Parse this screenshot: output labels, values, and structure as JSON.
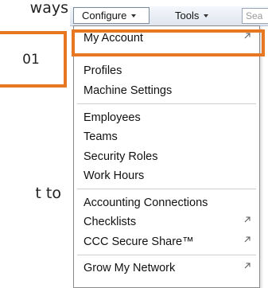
{
  "background_text": {
    "top": "ways",
    "bottom": "t to"
  },
  "menubar": {
    "configure_label": "Configure",
    "tools_label": "Tools",
    "search_text": "Sea"
  },
  "menu": {
    "items": [
      {
        "label": "My Account",
        "external": true
      },
      {
        "label": "Profiles",
        "external": false
      },
      {
        "label": "Machine Settings",
        "external": false
      },
      {
        "label": "Employees",
        "external": false
      },
      {
        "label": "Teams",
        "external": false
      },
      {
        "label": "Security Roles",
        "external": false
      },
      {
        "label": "Work Hours",
        "external": false
      },
      {
        "label": "Accounting Connections",
        "external": false
      },
      {
        "label": "Checklists",
        "external": true
      },
      {
        "label": "CCC Secure Share™",
        "external": true
      },
      {
        "label": "Grow My Network",
        "external": true
      }
    ],
    "icon": "external-link-icon"
  },
  "callout": {
    "label": "01"
  },
  "colors": {
    "highlight": "#e87722"
  }
}
